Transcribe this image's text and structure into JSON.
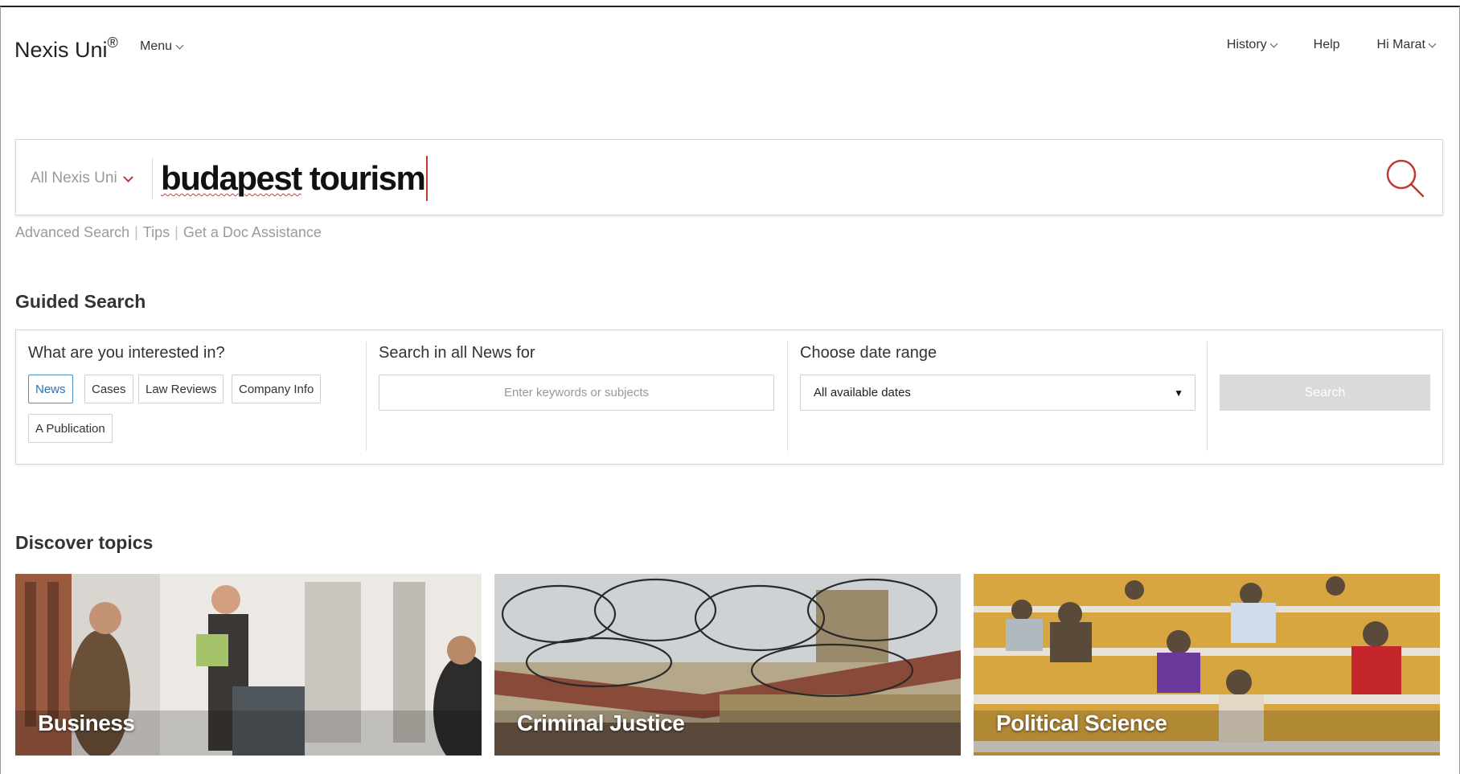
{
  "header": {
    "brand": "Nexis Uni",
    "brand_mark": "®",
    "menu_label": "Menu",
    "nav": [
      {
        "label": "History",
        "dropdown": true
      },
      {
        "label": "Help",
        "dropdown": false
      },
      {
        "label": "Hi Marat",
        "dropdown": true
      }
    ]
  },
  "search": {
    "scope_label": "All Nexis Uni",
    "query_word1": "budapest",
    "query_word2": "tourism",
    "icon": "search-icon",
    "accent_color": "#c0392b"
  },
  "assist_links": {
    "advanced": "Advanced Search",
    "tips": "Tips",
    "doc": "Get a Doc Assistance",
    "separator": "|"
  },
  "guided_search": {
    "title": "Guided Search",
    "interest_label": "What are you interested in?",
    "chips": [
      "News",
      "Cases",
      "Law Reviews",
      "Company Info",
      "A Publication"
    ],
    "active_chip": "News",
    "keywords_label": "Search in all News for",
    "keywords_placeholder": "Enter keywords or subjects",
    "date_label": "Choose date range",
    "date_value": "All available dates",
    "button_label": "Search"
  },
  "discover": {
    "title": "Discover topics",
    "topics": [
      "Business",
      "Criminal Justice",
      "Political Science"
    ]
  }
}
